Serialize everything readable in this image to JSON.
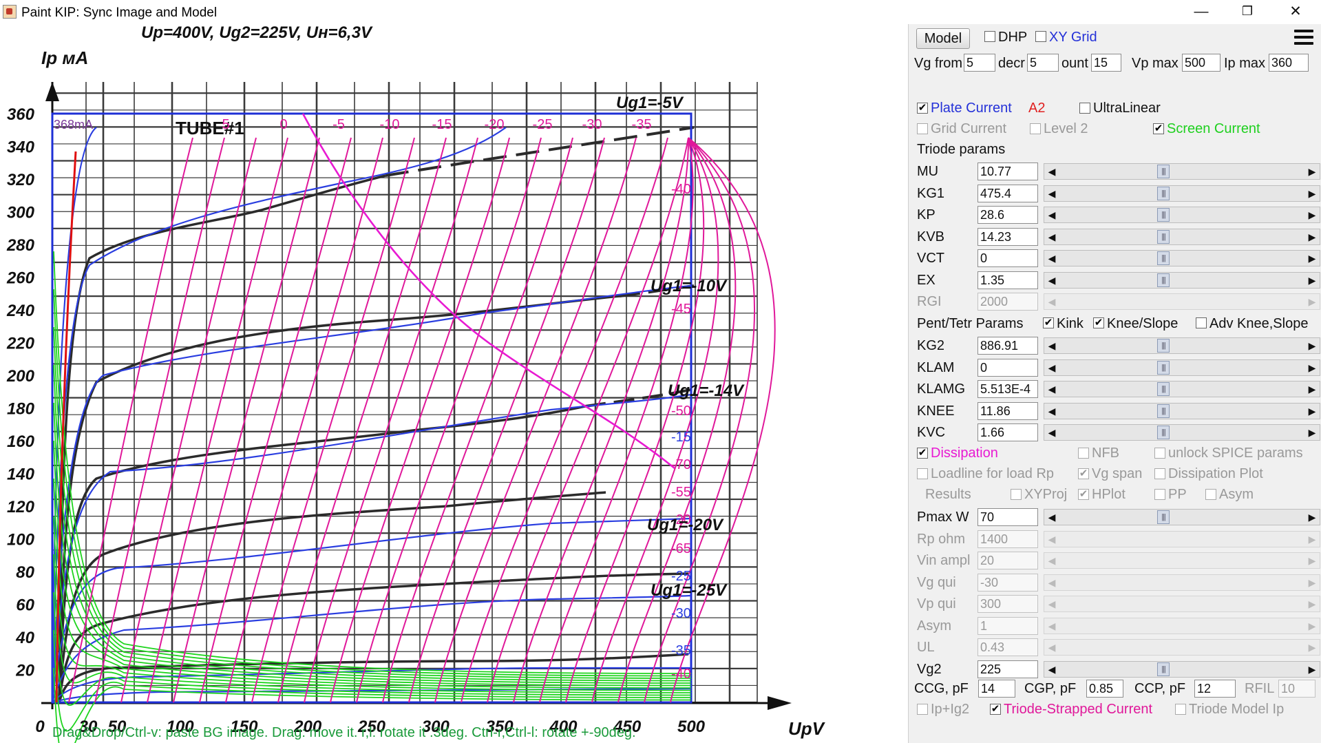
{
  "window": {
    "title": "Paint KIP: Sync Image and Model",
    "controls": {
      "minimize": "—",
      "restore": "❐",
      "close": "✕"
    }
  },
  "plot": {
    "header": "Up=400V, Ug2=225V, Uн=6,3V",
    "tube_label": "TUBE#1",
    "y_axis_label": "Ip мА",
    "x_axis_label": "UpV",
    "max_label": "368mA",
    "y_ticks": [
      "20",
      "40",
      "60",
      "80",
      "100",
      "120",
      "140",
      "160",
      "180",
      "200",
      "220",
      "240",
      "260",
      "280",
      "300",
      "320",
      "340",
      "360"
    ],
    "x_ticks": [
      "0",
      "30",
      "50",
      "100",
      "150",
      "200",
      "250",
      "300",
      "350",
      "400",
      "450",
      "500"
    ],
    "curve_labels": [
      "Ug1=-5V",
      "Ug1=-10V",
      "Ug1=-14V",
      "Ug1=-20V",
      "Ug1=-25V"
    ],
    "grid_top_labels": [
      "5",
      "0",
      "-5",
      "-10",
      "-15",
      "-20",
      "-25",
      "-30",
      "-35"
    ],
    "grid_right_labels": [
      "-40",
      "-45",
      "-50",
      "-15",
      "-70",
      "-55",
      "-20",
      "-65",
      "-25",
      "-30",
      "-35",
      "-40"
    ],
    "status": "Drag&Drop/Ctrl-v: paste BG image. Drag: move it. r,l: rotate it .3deg. Ctrl-r,Ctrl-l: rotate +-90deg."
  },
  "colors": {
    "model_grid": "#e0189a",
    "dissipation": "#e81ad2",
    "plate_current": "#2a3ee0",
    "screen_current": "#1ed41e",
    "frame": "#1e2fd6",
    "scanned_curve": "#2b2b2b",
    "red_curve": "#e01010"
  },
  "panel": {
    "model_button": "Model",
    "dhp": {
      "label": "DHP",
      "checked": false
    },
    "xy_grid": {
      "label": "XY Grid",
      "checked": false
    },
    "vg_from_label": "Vg from",
    "vg_from": "5",
    "decr_label": "decr",
    "decr": "5",
    "count_label": "ount",
    "count": "15",
    "vp_max_label": "Vp max",
    "vp_max": "500",
    "ip_max_label": "Ip max",
    "ip_max": "360",
    "plate_current": {
      "label": "Plate Current",
      "checked": true
    },
    "a2_label": "A2",
    "ultralinear": {
      "label": "UltraLinear",
      "checked": false
    },
    "grid_current": {
      "label": "Grid Current",
      "checked": false
    },
    "level2": {
      "label": "Level 2",
      "checked": false
    },
    "screen_current": {
      "label": "Screen Current",
      "checked": true
    },
    "triode_params_label": "Triode params",
    "triode_params": [
      {
        "name": "MU",
        "value": "10.77",
        "enabled": true
      },
      {
        "name": "KG1",
        "value": "475.4",
        "enabled": true
      },
      {
        "name": "KP",
        "value": "28.6",
        "enabled": true
      },
      {
        "name": "KVB",
        "value": "14.23",
        "enabled": true
      },
      {
        "name": "VCT",
        "value": "0",
        "enabled": true
      },
      {
        "name": "EX",
        "value": "1.35",
        "enabled": true
      },
      {
        "name": "RGI",
        "value": "2000",
        "enabled": false
      }
    ],
    "pent_params_label": "Pent/Tetr Params",
    "kink": {
      "label": "Kink",
      "checked": true
    },
    "knee_slope": {
      "label": "Knee/Slope",
      "checked": true
    },
    "adv_knee": {
      "label": "Adv Knee,Slope",
      "checked": false
    },
    "pent_params": [
      {
        "name": "KG2",
        "value": "886.91",
        "enabled": true
      },
      {
        "name": "KLAM",
        "value": "0",
        "enabled": true
      },
      {
        "name": "KLAMG",
        "value": "5.513E-4",
        "enabled": true
      },
      {
        "name": "KNEE",
        "value": "11.86",
        "enabled": true
      },
      {
        "name": "KVC",
        "value": "1.66",
        "enabled": true
      }
    ],
    "dissipation": {
      "label": "Dissipation",
      "checked": true
    },
    "nfb": {
      "label": "NFB",
      "checked": false
    },
    "unlock_spice": {
      "label": "unlock SPICE params",
      "checked": false
    },
    "loadline": {
      "label": "Loadline for load Rp",
      "checked": false
    },
    "vg_span": {
      "label": "Vg span",
      "checked": true
    },
    "dissipation_plot": {
      "label": "Dissipation Plot",
      "checked": false
    },
    "results_label": "Results",
    "xyproj": {
      "label": "XYProj",
      "checked": false
    },
    "hplot": {
      "label": "HPlot",
      "checked": true
    },
    "pp": {
      "label": "PP",
      "checked": false
    },
    "asym_cb": {
      "label": "Asym",
      "checked": false
    },
    "load_params": [
      {
        "name": "Pmax W",
        "value": "70",
        "enabled": true
      },
      {
        "name": "Rp ohm",
        "value": "1400",
        "enabled": false
      },
      {
        "name": "Vin ampl",
        "value": "20",
        "enabled": false
      },
      {
        "name": "Vg qui",
        "value": "-30",
        "enabled": false
      },
      {
        "name": "Vp qui",
        "value": "300",
        "enabled": false
      },
      {
        "name": "Asym",
        "value": "1",
        "enabled": false
      },
      {
        "name": "UL",
        "value": "0.43",
        "enabled": false
      },
      {
        "name": "Vg2",
        "value": "225",
        "enabled": true
      }
    ],
    "ccg_label": "CCG, pF",
    "ccg": "14",
    "cgp_label": "CGP, pF",
    "cgp": "0.85",
    "ccp_label": "CCP, pF",
    "ccp": "12",
    "rfil_label": "RFIL",
    "rfil": "10",
    "ip_ig2": {
      "label": "Ip+Ig2",
      "checked": false
    },
    "triode_strapped": {
      "label": "Triode-Strapped Current",
      "checked": true
    },
    "triode_model_ip": {
      "label": "Triode Model Ip",
      "checked": false
    }
  }
}
